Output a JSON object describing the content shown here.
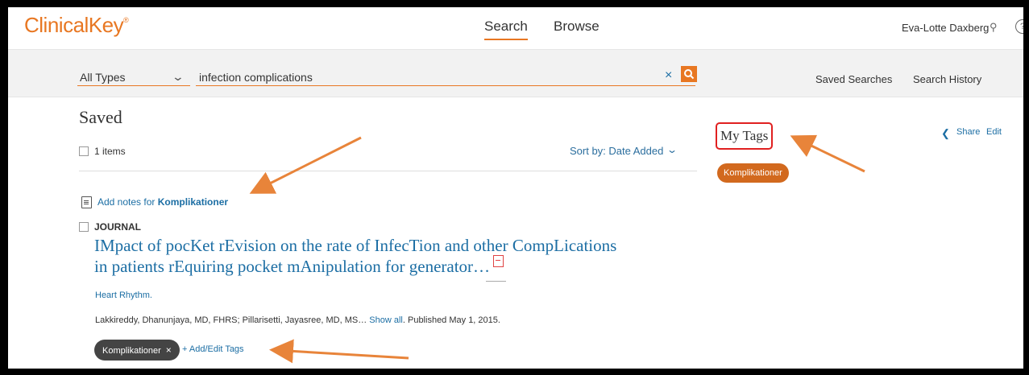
{
  "header": {
    "logo": "ClinicalKey",
    "logo_mark": "®",
    "nav": {
      "search": "Search",
      "browse": "Browse"
    },
    "user_name": "Eva-Lotte Daxberg",
    "user_icon": "person-icon",
    "help_icon": "help-icon",
    "help_glyph": "?"
  },
  "search": {
    "type_selected": "All Types",
    "query": "infection complications",
    "clear_glyph": "×",
    "submit_icon": "magnifier-icon",
    "saved_searches": "Saved Searches",
    "search_history": "Search History"
  },
  "saved": {
    "title": "Saved",
    "items_count": "1 items",
    "sort_label": "Sort by: Date Added",
    "add_notes_prefix": "Add notes for ",
    "add_notes_tag": "Komplikationer"
  },
  "results": [
    {
      "type": "JOURNAL",
      "title_line1": "IMpact of pocKet rEvision on the rate of InfecTion and other CompLications",
      "title_line2": "in patients rEquiring pocket mAnipulation for generator…",
      "journal": "Heart Rhythm.",
      "authors": "Lakkireddy, Dhanunjaya, MD, FHRS; Pillarisetti, Jayasree, MD, MS… ",
      "show_all": "Show all",
      "published": ". Published May 1, 2015.",
      "tag": "Komplikationer",
      "tag_remove": "×",
      "add_edit_tags": "+ Add/Edit Tags"
    }
  ],
  "sidebar": {
    "my_tags_title": "My Tags",
    "tags": [
      "Komplikationer"
    ],
    "share": "Share",
    "edit": "Edit"
  },
  "colors": {
    "brand_orange": "#e87722",
    "link_blue": "#1c6ea4",
    "tag_orange": "#d2691e",
    "annotation_orange": "#e8843a",
    "highlight_red": "#e02020"
  }
}
